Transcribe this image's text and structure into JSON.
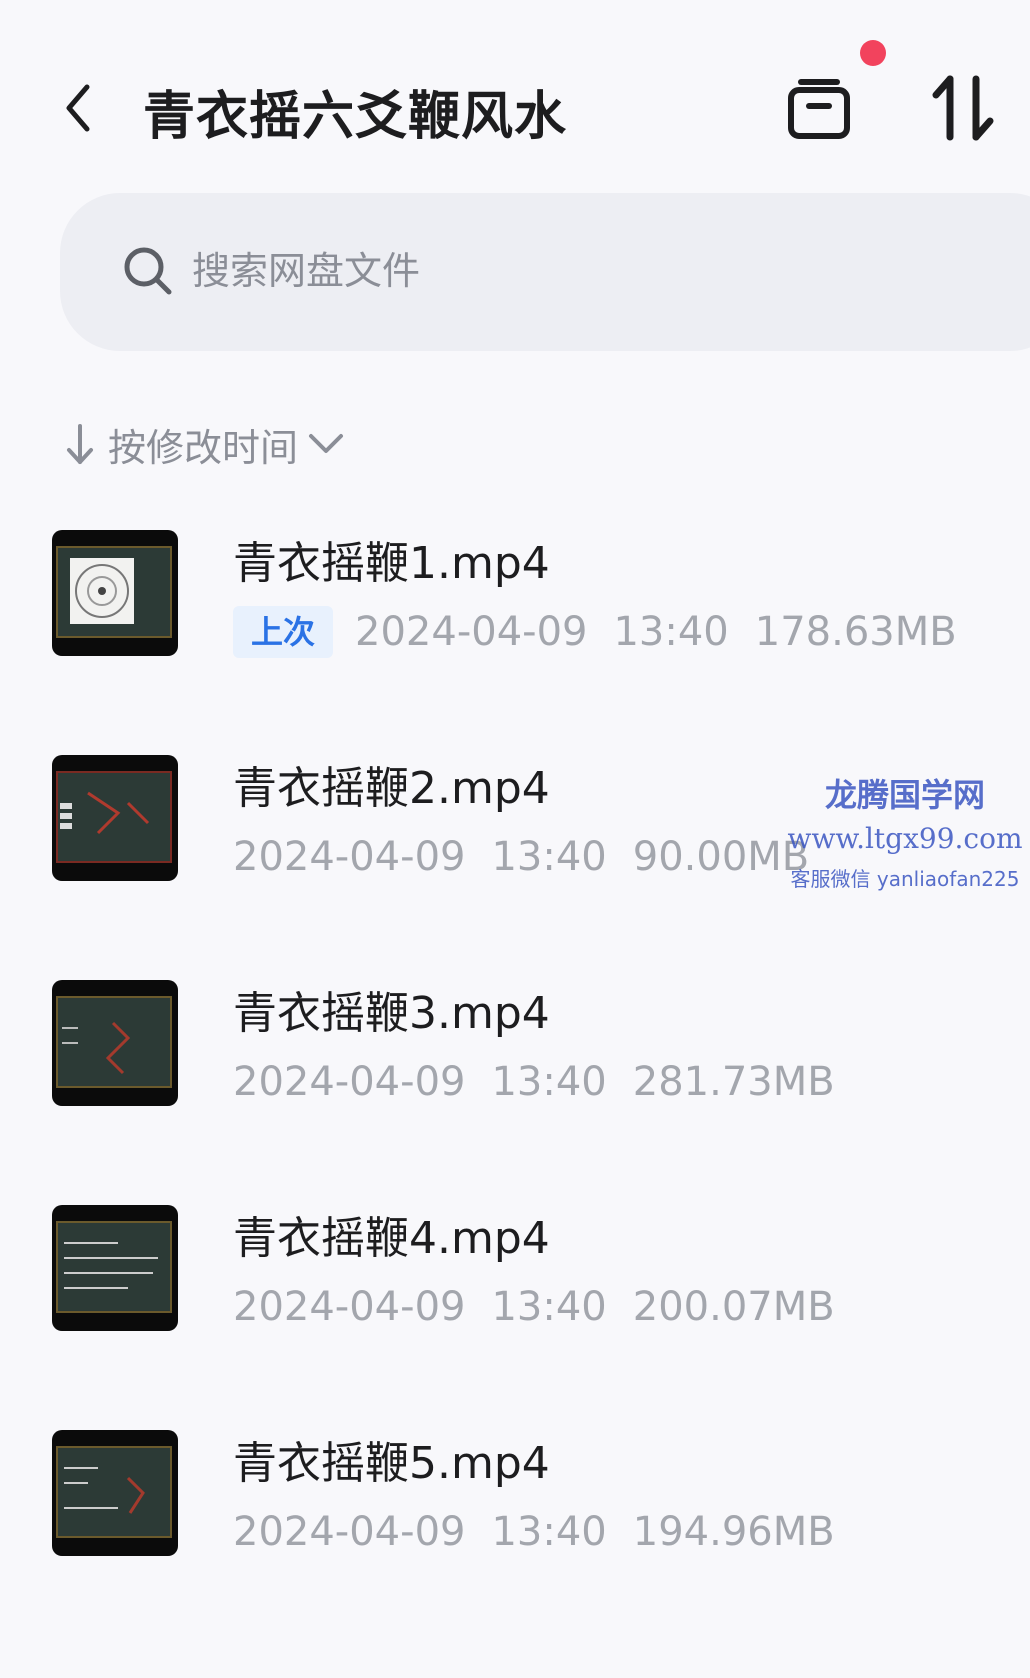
{
  "header": {
    "title": "青衣摇六爻鞭风水",
    "notification_color": "#f2435d"
  },
  "search": {
    "placeholder": "搜索网盘文件"
  },
  "sort": {
    "label": "按修改时间"
  },
  "files": [
    {
      "name": "青衣摇鞭1.mp4",
      "badge": "上次",
      "date": "2024-04-09",
      "time": "13:40",
      "size": "178.63MB",
      "icon": "video-thumbnail"
    },
    {
      "name": "青衣摇鞭2.mp4",
      "date": "2024-04-09",
      "time": "13:40",
      "size": "90.00MB",
      "icon": "video-thumbnail"
    },
    {
      "name": "青衣摇鞭3.mp4",
      "date": "2024-04-09",
      "time": "13:40",
      "size": "281.73MB",
      "icon": "video-thumbnail"
    },
    {
      "name": "青衣摇鞭4.mp4",
      "date": "2024-04-09",
      "time": "13:40",
      "size": "200.07MB",
      "icon": "video-thumbnail"
    },
    {
      "name": "青衣摇鞭5.mp4",
      "date": "2024-04-09",
      "time": "13:40",
      "size": "194.96MB",
      "icon": "video-thumbnail"
    }
  ],
  "watermark": {
    "title": "龙腾国学网",
    "url": "www.ltgx99.com",
    "contact": "客服微信 yanliaofan225"
  },
  "colors": {
    "accent": "#2a72e5",
    "badge_bg": "#e8f1fd",
    "muted_text": "#a3a6ad",
    "search_bg": "#edeef3"
  }
}
